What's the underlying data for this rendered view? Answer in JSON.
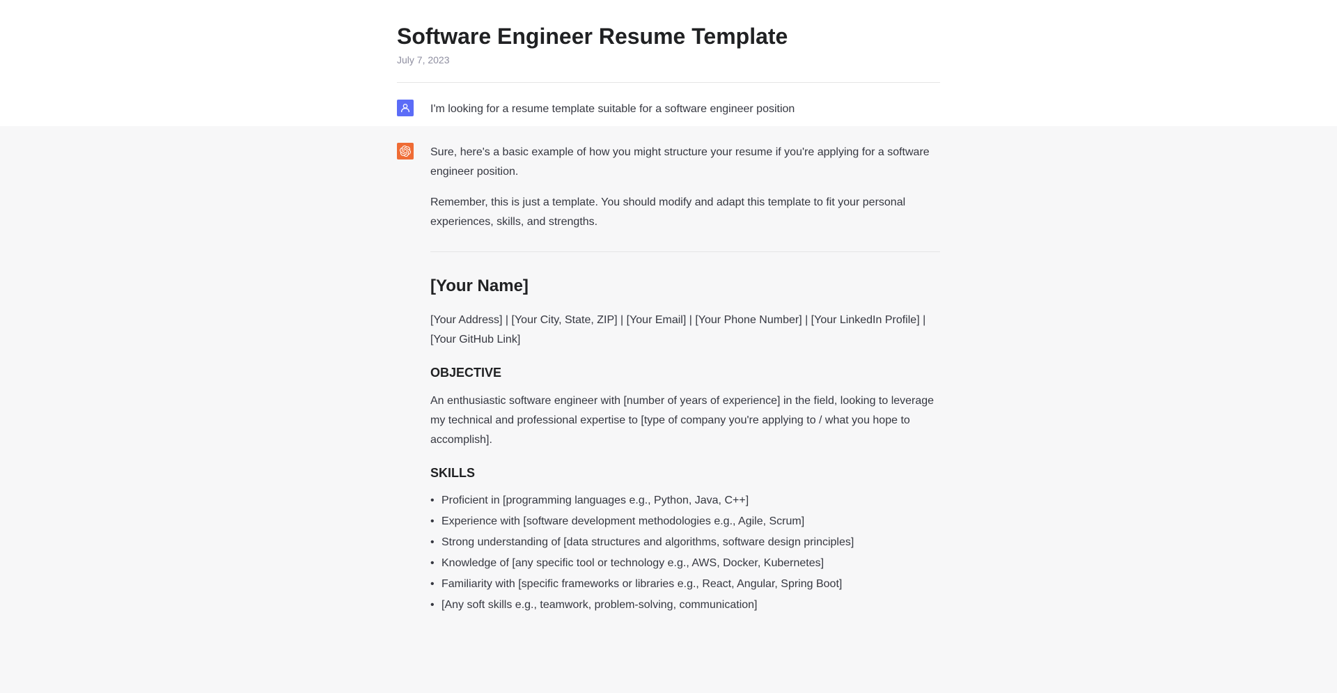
{
  "header": {
    "title": "Software Engineer Resume Template",
    "date": "July 7, 2023"
  },
  "messages": {
    "user": {
      "text": "I'm looking for a resume template suitable for a software engineer position"
    },
    "assistant": {
      "intro1": "Sure, here's a basic example of how you might structure your resume if you're applying for a software engineer position.",
      "intro2": "Remember, this is just a template. You should modify and adapt this template to fit your personal experiences, skills, and strengths.",
      "resume": {
        "name_heading": "[Your Name]",
        "contact_line": "[Your Address] | [Your City, State, ZIP] | [Your Email] | [Your Phone Number] | [Your LinkedIn Profile] | [Your GitHub Link]",
        "objective_heading": "OBJECTIVE",
        "objective_body": "An enthusiastic software engineer with [number of years of experience] in the field, looking to leverage my technical and professional expertise to [type of company you're applying to / what you hope to accomplish].",
        "skills_heading": "SKILLS",
        "skills": [
          "Proficient in [programming languages e.g., Python, Java, C++]",
          "Experience with [software development methodologies e.g., Agile, Scrum]",
          "Strong understanding of [data structures and algorithms, software design principles]",
          "Knowledge of [any specific tool or technology e.g., AWS, Docker, Kubernetes]",
          "Familiarity with [specific frameworks or libraries e.g., React, Angular, Spring Boot]",
          "[Any soft skills e.g., teamwork, problem-solving, communication]"
        ]
      }
    }
  }
}
